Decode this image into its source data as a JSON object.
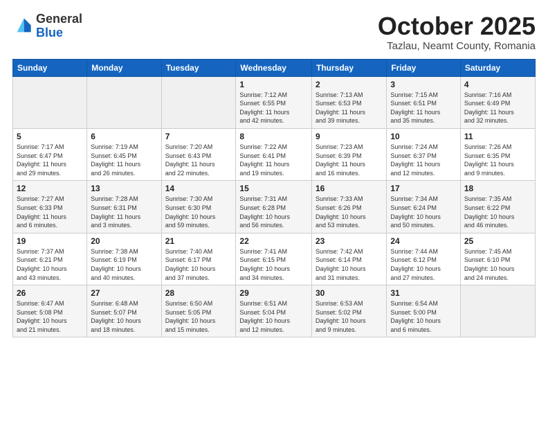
{
  "header": {
    "logo_general": "General",
    "logo_blue": "Blue",
    "title": "October 2025",
    "location": "Tazlau, Neamt County, Romania"
  },
  "weekdays": [
    "Sunday",
    "Monday",
    "Tuesday",
    "Wednesday",
    "Thursday",
    "Friday",
    "Saturday"
  ],
  "weeks": [
    [
      {
        "num": "",
        "info": ""
      },
      {
        "num": "",
        "info": ""
      },
      {
        "num": "",
        "info": ""
      },
      {
        "num": "1",
        "info": "Sunrise: 7:12 AM\nSunset: 6:55 PM\nDaylight: 11 hours\nand 42 minutes."
      },
      {
        "num": "2",
        "info": "Sunrise: 7:13 AM\nSunset: 6:53 PM\nDaylight: 11 hours\nand 39 minutes."
      },
      {
        "num": "3",
        "info": "Sunrise: 7:15 AM\nSunset: 6:51 PM\nDaylight: 11 hours\nand 35 minutes."
      },
      {
        "num": "4",
        "info": "Sunrise: 7:16 AM\nSunset: 6:49 PM\nDaylight: 11 hours\nand 32 minutes."
      }
    ],
    [
      {
        "num": "5",
        "info": "Sunrise: 7:17 AM\nSunset: 6:47 PM\nDaylight: 11 hours\nand 29 minutes."
      },
      {
        "num": "6",
        "info": "Sunrise: 7:19 AM\nSunset: 6:45 PM\nDaylight: 11 hours\nand 26 minutes."
      },
      {
        "num": "7",
        "info": "Sunrise: 7:20 AM\nSunset: 6:43 PM\nDaylight: 11 hours\nand 22 minutes."
      },
      {
        "num": "8",
        "info": "Sunrise: 7:22 AM\nSunset: 6:41 PM\nDaylight: 11 hours\nand 19 minutes."
      },
      {
        "num": "9",
        "info": "Sunrise: 7:23 AM\nSunset: 6:39 PM\nDaylight: 11 hours\nand 16 minutes."
      },
      {
        "num": "10",
        "info": "Sunrise: 7:24 AM\nSunset: 6:37 PM\nDaylight: 11 hours\nand 12 minutes."
      },
      {
        "num": "11",
        "info": "Sunrise: 7:26 AM\nSunset: 6:35 PM\nDaylight: 11 hours\nand 9 minutes."
      }
    ],
    [
      {
        "num": "12",
        "info": "Sunrise: 7:27 AM\nSunset: 6:33 PM\nDaylight: 11 hours\nand 6 minutes."
      },
      {
        "num": "13",
        "info": "Sunrise: 7:28 AM\nSunset: 6:31 PM\nDaylight: 11 hours\nand 3 minutes."
      },
      {
        "num": "14",
        "info": "Sunrise: 7:30 AM\nSunset: 6:30 PM\nDaylight: 10 hours\nand 59 minutes."
      },
      {
        "num": "15",
        "info": "Sunrise: 7:31 AM\nSunset: 6:28 PM\nDaylight: 10 hours\nand 56 minutes."
      },
      {
        "num": "16",
        "info": "Sunrise: 7:33 AM\nSunset: 6:26 PM\nDaylight: 10 hours\nand 53 minutes."
      },
      {
        "num": "17",
        "info": "Sunrise: 7:34 AM\nSunset: 6:24 PM\nDaylight: 10 hours\nand 50 minutes."
      },
      {
        "num": "18",
        "info": "Sunrise: 7:35 AM\nSunset: 6:22 PM\nDaylight: 10 hours\nand 46 minutes."
      }
    ],
    [
      {
        "num": "19",
        "info": "Sunrise: 7:37 AM\nSunset: 6:21 PM\nDaylight: 10 hours\nand 43 minutes."
      },
      {
        "num": "20",
        "info": "Sunrise: 7:38 AM\nSunset: 6:19 PM\nDaylight: 10 hours\nand 40 minutes."
      },
      {
        "num": "21",
        "info": "Sunrise: 7:40 AM\nSunset: 6:17 PM\nDaylight: 10 hours\nand 37 minutes."
      },
      {
        "num": "22",
        "info": "Sunrise: 7:41 AM\nSunset: 6:15 PM\nDaylight: 10 hours\nand 34 minutes."
      },
      {
        "num": "23",
        "info": "Sunrise: 7:42 AM\nSunset: 6:14 PM\nDaylight: 10 hours\nand 31 minutes."
      },
      {
        "num": "24",
        "info": "Sunrise: 7:44 AM\nSunset: 6:12 PM\nDaylight: 10 hours\nand 27 minutes."
      },
      {
        "num": "25",
        "info": "Sunrise: 7:45 AM\nSunset: 6:10 PM\nDaylight: 10 hours\nand 24 minutes."
      }
    ],
    [
      {
        "num": "26",
        "info": "Sunrise: 6:47 AM\nSunset: 5:08 PM\nDaylight: 10 hours\nand 21 minutes."
      },
      {
        "num": "27",
        "info": "Sunrise: 6:48 AM\nSunset: 5:07 PM\nDaylight: 10 hours\nand 18 minutes."
      },
      {
        "num": "28",
        "info": "Sunrise: 6:50 AM\nSunset: 5:05 PM\nDaylight: 10 hours\nand 15 minutes."
      },
      {
        "num": "29",
        "info": "Sunrise: 6:51 AM\nSunset: 5:04 PM\nDaylight: 10 hours\nand 12 minutes."
      },
      {
        "num": "30",
        "info": "Sunrise: 6:53 AM\nSunset: 5:02 PM\nDaylight: 10 hours\nand 9 minutes."
      },
      {
        "num": "31",
        "info": "Sunrise: 6:54 AM\nSunset: 5:00 PM\nDaylight: 10 hours\nand 6 minutes."
      },
      {
        "num": "",
        "info": ""
      }
    ]
  ]
}
